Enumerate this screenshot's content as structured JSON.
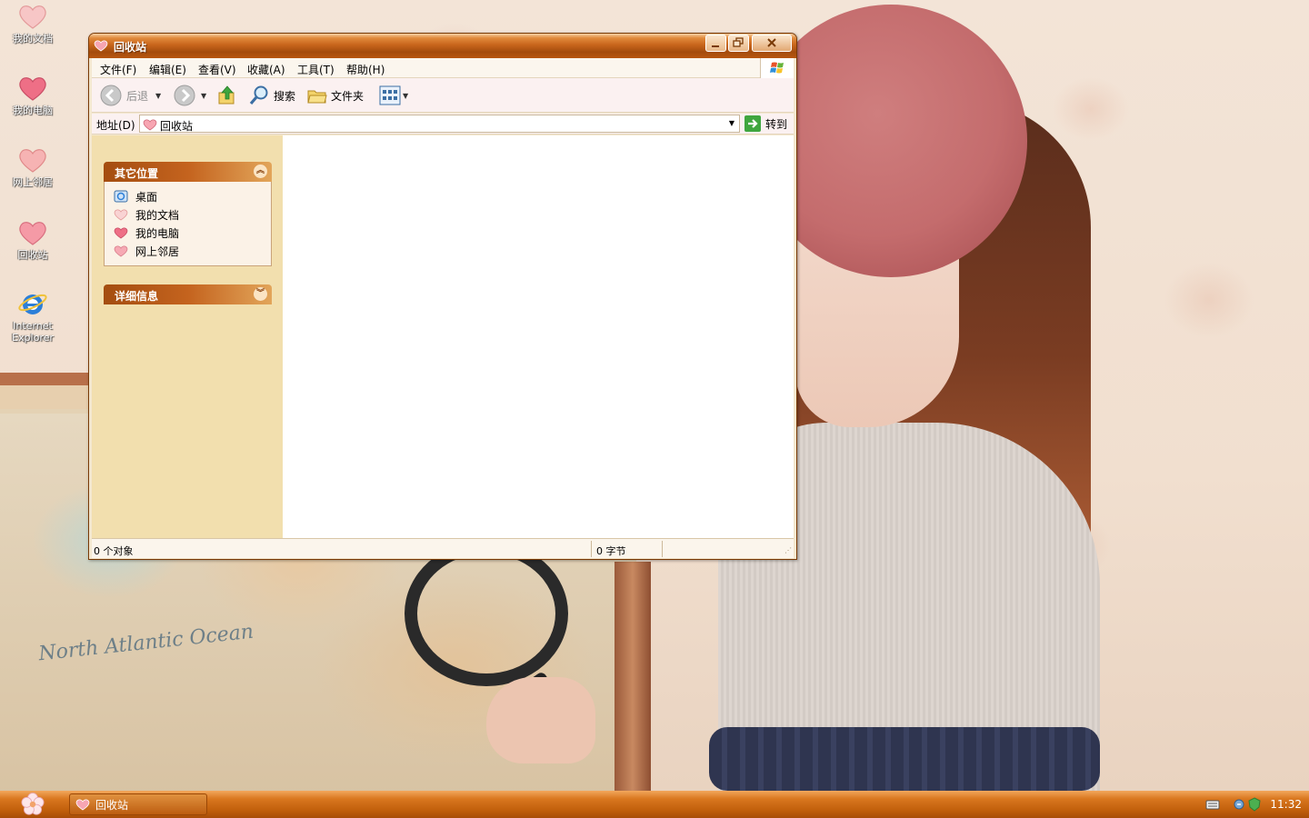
{
  "desktop": {
    "icons": [
      {
        "label": "我的文档"
      },
      {
        "label": "我的电脑"
      },
      {
        "label": "网上邻居"
      },
      {
        "label": "回收站"
      },
      {
        "label": "Internet Explorer"
      }
    ]
  },
  "wallpaper": {
    "map_text": "North Atlantic Ocean"
  },
  "window": {
    "title": "回收站",
    "menu": [
      "文件(F)",
      "编辑(E)",
      "查看(V)",
      "收藏(A)",
      "工具(T)",
      "帮助(H)"
    ],
    "toolbar": {
      "back_label": "后退",
      "search_label": "搜索",
      "folders_label": "文件夹"
    },
    "address": {
      "label": "地址(D)",
      "value": "回收站",
      "go_label": "转到"
    },
    "taskpane": {
      "other_places": {
        "title": "其它位置",
        "items": [
          {
            "label": "桌面",
            "icon": "desktop-icon"
          },
          {
            "label": "我的文档",
            "icon": "heart-icon"
          },
          {
            "label": "我的电脑",
            "icon": "heart-icon"
          },
          {
            "label": "网上邻居",
            "icon": "heart-icon"
          }
        ]
      },
      "details": {
        "title": "详细信息"
      }
    },
    "status": {
      "objects": "0 个对象",
      "size": "0 字节"
    }
  },
  "taskbar": {
    "task_label": "回收站",
    "clock": "11:32"
  },
  "colors": {
    "titlebar": "#c9661c",
    "taskbar": "#c2600c",
    "taskpane": "#f2dfae"
  }
}
